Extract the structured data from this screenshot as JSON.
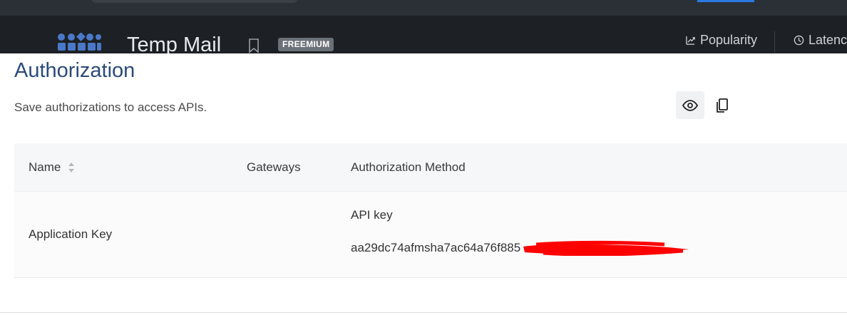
{
  "header": {
    "api_title": "Temp Mail",
    "plan_badge": "FREEMIUM",
    "stats": [
      {
        "label": "Popularity",
        "icon": "trend-icon"
      },
      {
        "label": "Latenc",
        "icon": "clock-icon"
      }
    ]
  },
  "section": {
    "title": "Authorization",
    "description": "Save authorizations to access APIs."
  },
  "table": {
    "columns": [
      "Name",
      "Gateways",
      "Authorization Method"
    ],
    "rows": [
      {
        "name": "Application Key",
        "gateways": "",
        "method_label": "API key",
        "key_value": "aa29dc74afmsha7ac64a76f885"
      }
    ]
  },
  "colors": {
    "topbar": "#2b3036",
    "apibar": "#1d2024",
    "title_blue": "#2a4a7a",
    "redaction_red": "#ff0000",
    "logo_blue": "#4a78c8"
  }
}
